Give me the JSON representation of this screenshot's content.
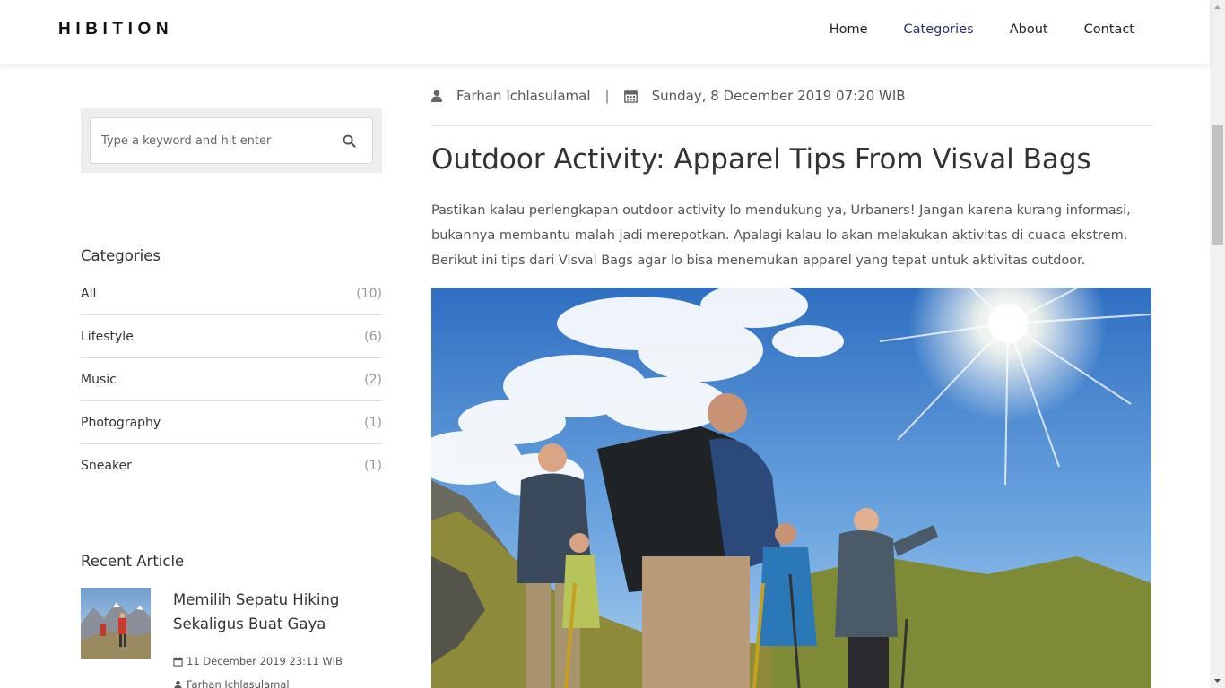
{
  "navbar": {
    "brand": "HIBITION",
    "links": [
      {
        "label": "Home",
        "active": false
      },
      {
        "label": "Categories",
        "active": true
      },
      {
        "label": "About",
        "active": false
      },
      {
        "label": "Contact",
        "active": false
      }
    ]
  },
  "sidebar": {
    "search": {
      "placeholder": "Type a keyword and hit enter",
      "icon": "search-icon"
    },
    "categories_heading": "Categories",
    "categories": [
      {
        "name": "All",
        "count": "(10)"
      },
      {
        "name": "Lifestyle",
        "count": "(6)"
      },
      {
        "name": "Music",
        "count": "(2)"
      },
      {
        "name": "Photography",
        "count": "(1)"
      },
      {
        "name": "Sneaker",
        "count": "(1)"
      }
    ],
    "recent_heading": "Recent Article",
    "recent": [
      {
        "title": "Memilih Sepatu Hiking Sekaligus Buat Gaya",
        "date": "11 December 2019 23:11 WIB",
        "author": "Farhan Ichlasulamal"
      }
    ]
  },
  "article": {
    "author": "Farhan Ichlasulamal",
    "separator": "|",
    "date": "Sunday, 8 December 2019 07:20 WIB",
    "title": "Outdoor Activity: Apparel Tips From Visval Bags",
    "body": "Pastikan kalau perlengkapan outdoor activity lo mendukung ya, Urbaners! Jangan karena kurang informasi, bukannya membantu malah jadi merepotkan. Apalagi kalau lo akan melakukan aktivitas di cuaca ekstrem. Berikut ini tips dari Visval Bags agar lo bisa menemukan apparel yang tepat untuk aktivitas outdoor."
  },
  "colors": {
    "nav_active": "#2a2f7a",
    "search_bg": "#eeeeee",
    "text": "#333333",
    "muted": "#999999"
  }
}
